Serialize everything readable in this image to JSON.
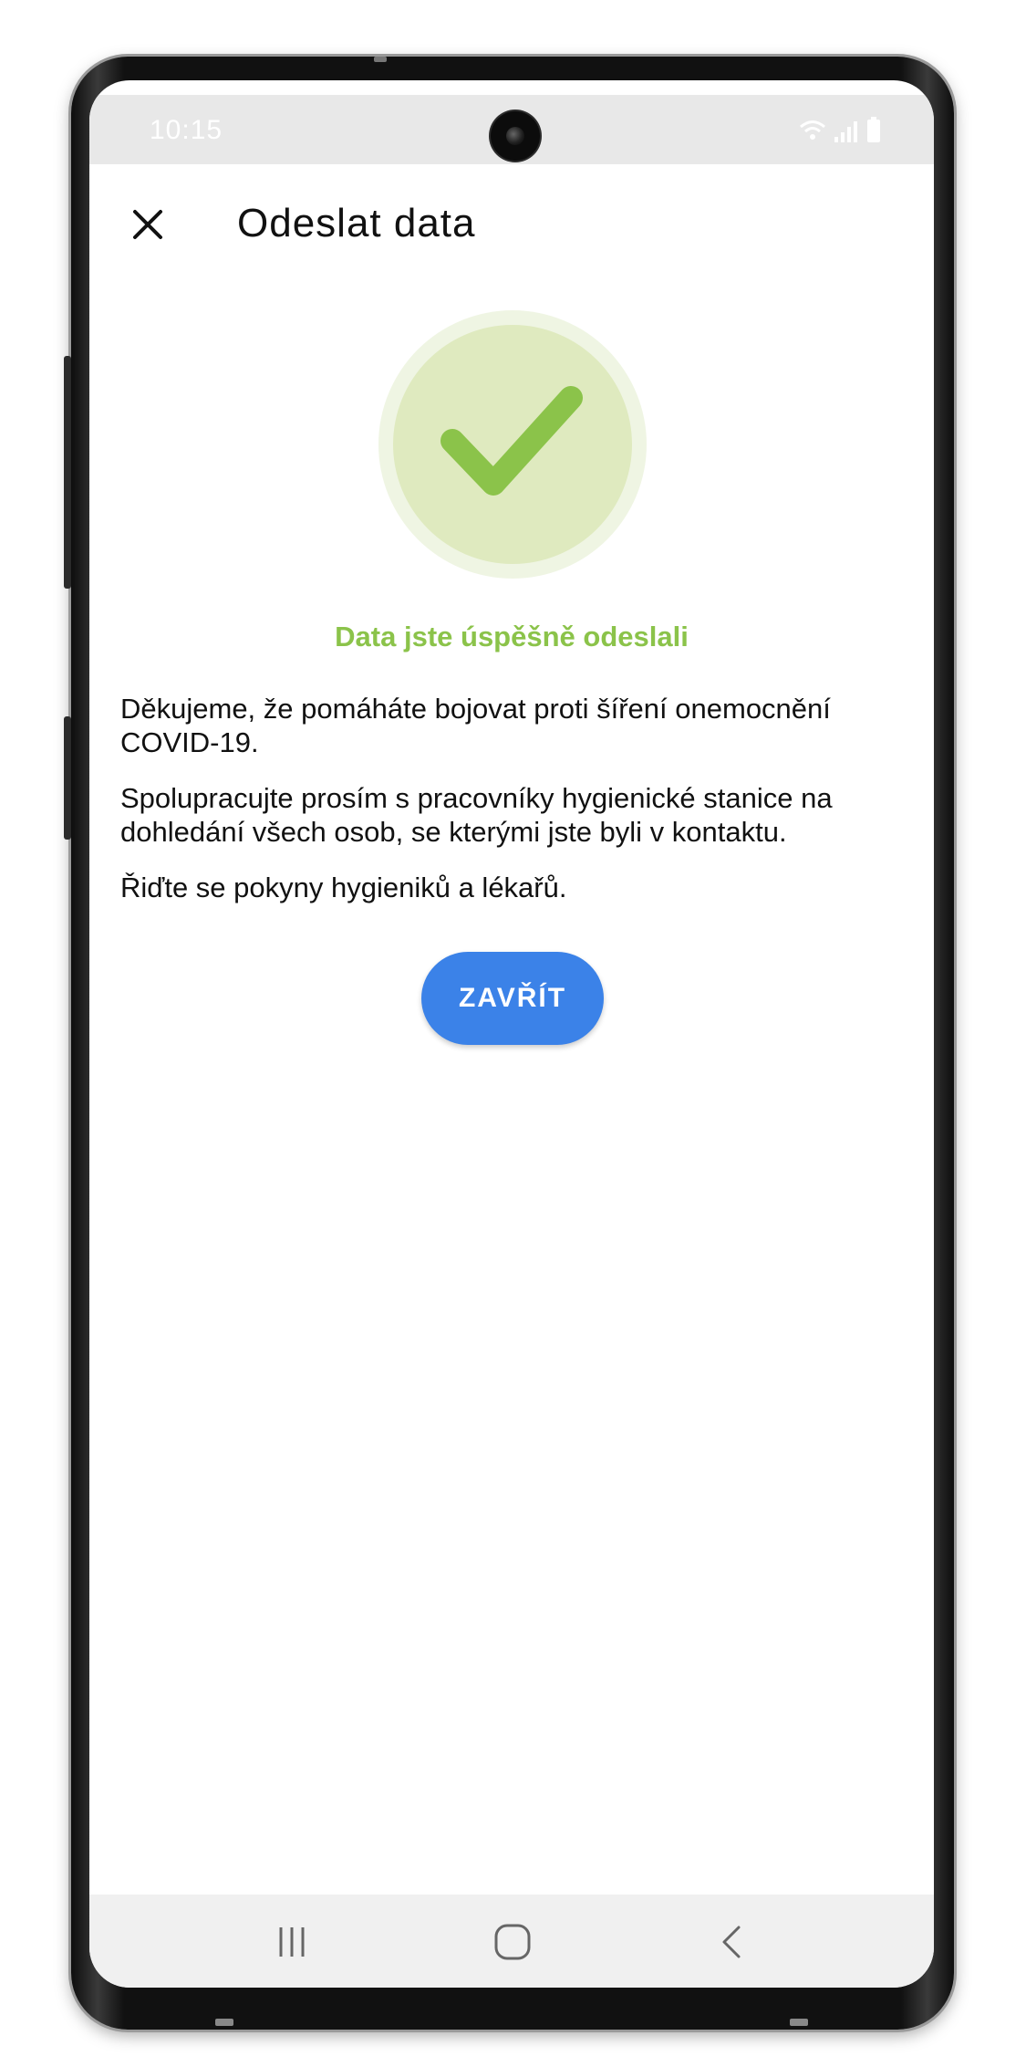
{
  "status_bar": {
    "time": "10:15",
    "icons": [
      "wifi-icon",
      "signal-icon",
      "battery-icon"
    ]
  },
  "app_bar": {
    "title": "Odeslat data",
    "close_icon": "close-icon"
  },
  "success": {
    "icon": "check-icon",
    "heading": "Data jste úspěšně odeslali"
  },
  "body": {
    "paragraphs": [
      "Děkujeme, že pomáháte bojovat proti šíření onemocnění COVID-19.",
      "Spolupracujte prosím s pracovníky hygienické stanice na dohledání všech osob, se kterými jste byli v kontaktu.",
      "Řiďte se pokyny hygieniků a lékařů."
    ]
  },
  "actions": {
    "close_label": "ZAVŘÍT"
  },
  "nav_bar": {
    "buttons": [
      "recent-apps-icon",
      "home-icon",
      "back-icon"
    ]
  },
  "colors": {
    "accent": "#3b82e8",
    "success_green": "#8bc34a",
    "success_circle": "#dfeabf"
  }
}
